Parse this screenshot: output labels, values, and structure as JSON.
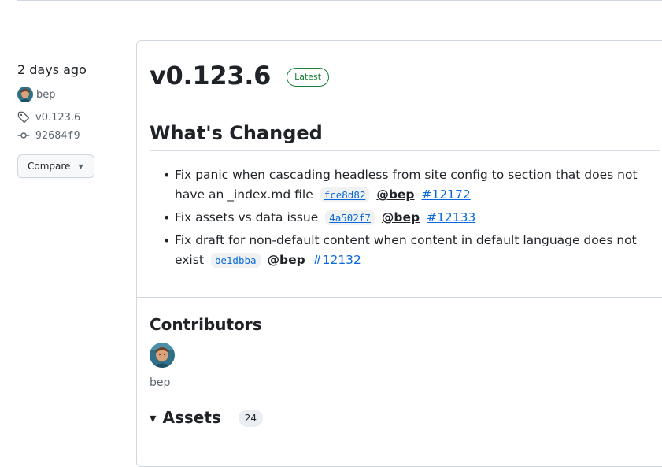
{
  "sidebar": {
    "time": "2 days ago",
    "author": "bep",
    "tag": "v0.123.6",
    "commit": "92684f9",
    "compare_label": "Compare"
  },
  "release": {
    "title": "v0.123.6",
    "badge": "Latest",
    "changes_heading": "What's Changed",
    "changes": [
      {
        "text": "Fix panic when cascading headless from site config to section that does not have an _index.md file",
        "sha": "fce8d82",
        "author": "@bep",
        "issue": "#12172"
      },
      {
        "text": "Fix assets vs data issue",
        "sha": "4a502f7",
        "author": "@bep",
        "issue": "#12133"
      },
      {
        "text": "Fix draft for non-default content when content in default language does not exist",
        "sha": "be1dbba",
        "author": "@bep",
        "issue": "#12132"
      }
    ]
  },
  "contributors": {
    "heading": "Contributors",
    "names": [
      "bep"
    ]
  },
  "assets": {
    "heading": "Assets",
    "count": "24"
  },
  "colors": {
    "link": "#0969da",
    "latest_badge": "#1a7f37",
    "border": "#d0d7de",
    "muted_text": "#59636e"
  },
  "icons": [
    "tag-icon",
    "git-commit-icon",
    "caret-down-icon",
    "triangle-down-icon"
  ]
}
